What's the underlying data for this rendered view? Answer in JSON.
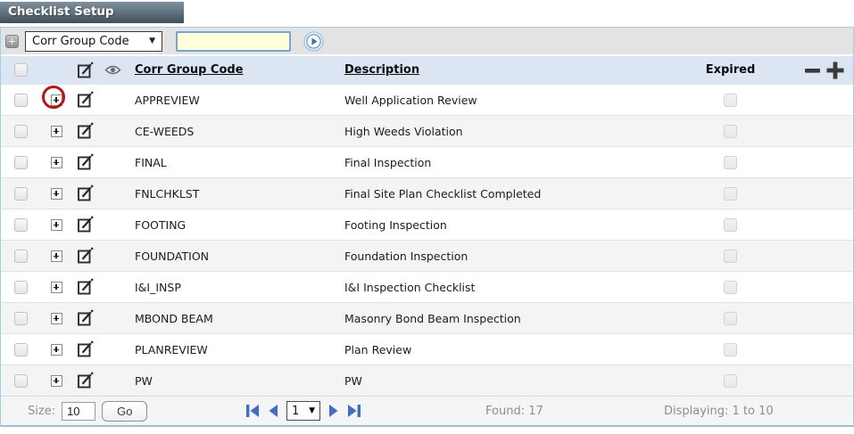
{
  "window": {
    "title": "Checklist Setup"
  },
  "toolbar": {
    "add_icon": "plus-square-icon",
    "field_select": {
      "selected": "Corr Group Code"
    },
    "search_input": {
      "value": "",
      "placeholder": ""
    },
    "submit_icon": "circle-play-icon"
  },
  "table": {
    "headers": {
      "code": "Corr Group Code",
      "description": "Description",
      "expired": "Expired"
    },
    "header_icons": [
      "edit-icon",
      "eye-icon",
      "minus-icon",
      "plus-icon"
    ],
    "rows": [
      {
        "code": "APPREVIEW",
        "description": "Well Application Review",
        "expired": false,
        "annotated": true
      },
      {
        "code": "CE-WEEDS",
        "description": "High Weeds Violation",
        "expired": false
      },
      {
        "code": "FINAL",
        "description": "Final Inspection",
        "expired": false
      },
      {
        "code": "FNLCHKLST",
        "description": "Final Site Plan Checklist Completed",
        "expired": false
      },
      {
        "code": "FOOTING",
        "description": "Footing Inspection",
        "expired": false
      },
      {
        "code": "FOUNDATION",
        "description": "Foundation Inspection",
        "expired": false
      },
      {
        "code": "I&I_INSP",
        "description": "I&I Inspection Checklist",
        "expired": false
      },
      {
        "code": "MBOND BEAM",
        "description": "Masonry Bond Beam Inspection",
        "expired": false
      },
      {
        "code": "PLANREVIEW",
        "description": "Plan Review",
        "expired": false
      },
      {
        "code": "PW",
        "description": "PW",
        "expired": false
      }
    ],
    "annotation": "red-circle around first row expand icon"
  },
  "footer": {
    "size_label": "Size:",
    "size_value": "10",
    "go_label": "Go",
    "page_value": "1",
    "found_text": "Found: 17",
    "displaying_text": "Displaying: 1 to 10"
  },
  "colors": {
    "title_bg": "#4f6470",
    "header_bg": "#dbe6f2",
    "frame_border": "#aacbe4",
    "row_alt": "#f4f4f4",
    "search_bg": "#ffffd8",
    "search_border": "#72a5d8",
    "pagination_blue": "#3d6ecd",
    "annotation_red": "#c90d0d"
  }
}
